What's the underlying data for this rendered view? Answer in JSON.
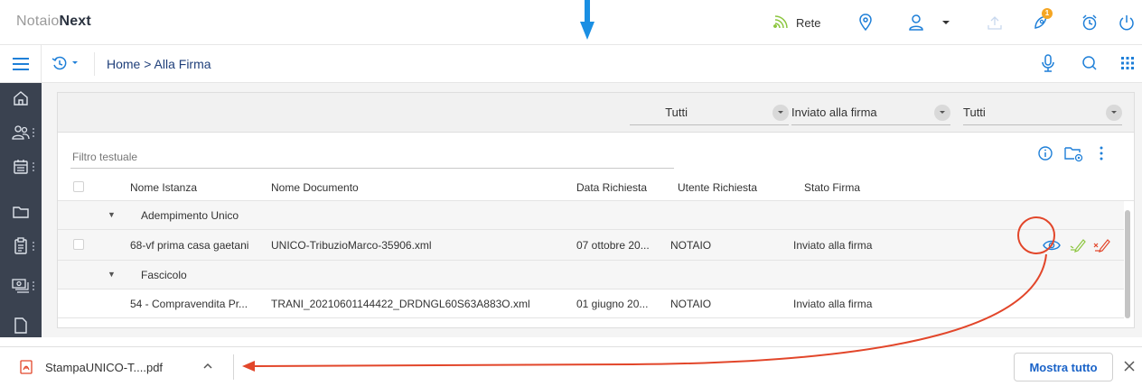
{
  "app": {
    "logo_part1": "Notaio",
    "logo_part2": "Next"
  },
  "topbar": {
    "network_label": "Rete",
    "notification_count": "1"
  },
  "breadcrumb": {
    "text": "Home > Alla Firma"
  },
  "filters": {
    "filter1": "Tutti",
    "filter2": "Inviato alla firma",
    "filter3": "Tutti"
  },
  "search": {
    "placeholder": "Filtro testuale"
  },
  "table": {
    "headers": {
      "nome_istanza": "Nome Istanza",
      "nome_documento": "Nome Documento",
      "data_richiesta": "Data Richiesta",
      "utente_richiesta": "Utente Richiesta",
      "stato_firma": "Stato Firma"
    },
    "groups": [
      {
        "name": "Adempimento Unico",
        "rows": [
          {
            "istanza": "68-vf prima casa gaetani",
            "documento": "UNICO-TribuzioMarco-35906.xml",
            "data": "07 ottobre 20...",
            "utente": "NOTAIO",
            "stato": "Inviato alla firma"
          }
        ]
      },
      {
        "name": "Fascicolo",
        "rows": [
          {
            "istanza": "54 - Compravendita Pr...",
            "documento": "TRANI_20210601144422_DRDNGL60S63A883O.xml",
            "data": "01 giugno 20...",
            "utente": "NOTAIO",
            "stato": "Inviato alla firma"
          }
        ]
      }
    ]
  },
  "download": {
    "file_name": "StampaUNICO-T....pdf",
    "show_all": "Mostra tutto"
  },
  "colors": {
    "accent": "#1e7fd8",
    "sidebar": "#3a4250",
    "annotation": "#e2462a",
    "approve": "#8cc63f"
  }
}
